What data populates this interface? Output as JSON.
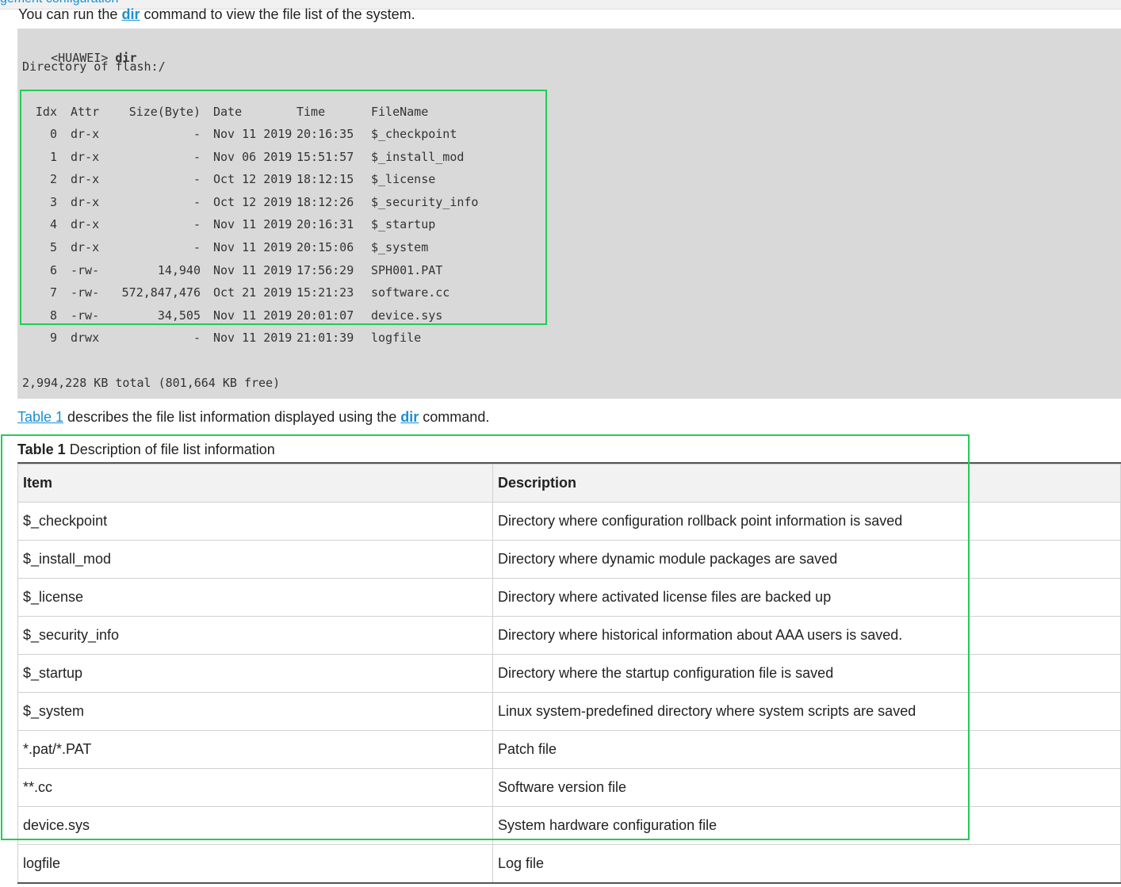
{
  "header": {
    "heading_fragment": "gement configuration"
  },
  "intro": {
    "prefix": "You can run the ",
    "command": "dir",
    "suffix": " command to view the file list of the system."
  },
  "code": {
    "prompt": "<HUAWEI>",
    "command": "dir",
    "directory_line": "Directory of flash:/",
    "columns": [
      "Idx",
      "Attr",
      "Size(Byte)",
      "Date",
      "Time",
      "FileName"
    ],
    "rows": [
      [
        "0",
        "dr-x",
        "-",
        "Nov 11 2019",
        "20:16:35",
        "$_checkpoint"
      ],
      [
        "1",
        "dr-x",
        "-",
        "Nov 06 2019",
        "15:51:57",
        "$_install_mod"
      ],
      [
        "2",
        "dr-x",
        "-",
        "Oct 12 2019",
        "18:12:15",
        "$_license"
      ],
      [
        "3",
        "dr-x",
        "-",
        "Oct 12 2019",
        "18:12:26",
        "$_security_info"
      ],
      [
        "4",
        "dr-x",
        "-",
        "Nov 11 2019",
        "20:16:31",
        "$_startup"
      ],
      [
        "5",
        "dr-x",
        "-",
        "Nov 11 2019",
        "20:15:06",
        "$_system"
      ],
      [
        "6",
        "-rw-",
        "14,940",
        "Nov 11 2019",
        "17:56:29",
        "SPH001.PAT"
      ],
      [
        "7",
        "-rw-",
        "572,847,476",
        "Oct 21 2019",
        "15:21:23",
        "software.cc"
      ],
      [
        "8",
        "-rw-",
        "34,505",
        "Nov 11 2019",
        "20:01:07",
        "device.sys"
      ],
      [
        "9",
        "drwx",
        "-",
        "Nov 11 2019",
        "21:01:39",
        "logfile"
      ]
    ],
    "total_line": "2,994,228 KB total (801,664 KB free)"
  },
  "description": {
    "table_ref": "Table 1",
    "middle": " describes the file list information displayed using the ",
    "command": "dir",
    "suffix": " command."
  },
  "table": {
    "caption_number": "Table 1",
    "caption_text": " Description of file list information",
    "headers": [
      "Item",
      "Description"
    ],
    "rows": [
      [
        "$_checkpoint",
        "Directory where configuration rollback point information is saved"
      ],
      [
        "$_install_mod",
        "Directory where dynamic module packages are saved"
      ],
      [
        "$_license",
        "Directory where activated license files are backed up"
      ],
      [
        "$_security_info",
        "Directory where historical information about AAA users is saved."
      ],
      [
        "$_startup",
        "Directory where the startup configuration file is saved"
      ],
      [
        "$_system",
        "Linux system-predefined directory where system scripts are saved"
      ],
      [
        "*.pat/*.PAT",
        "Patch file"
      ],
      [
        "**.cc",
        "Software version file"
      ],
      [
        "device.sys",
        "System hardware configuration file"
      ],
      [
        "logfile",
        "Log file"
      ]
    ]
  },
  "colors": {
    "link": "#1a8fd6",
    "highlight": "#22cc55",
    "code_bg": "#d9d9d9"
  }
}
